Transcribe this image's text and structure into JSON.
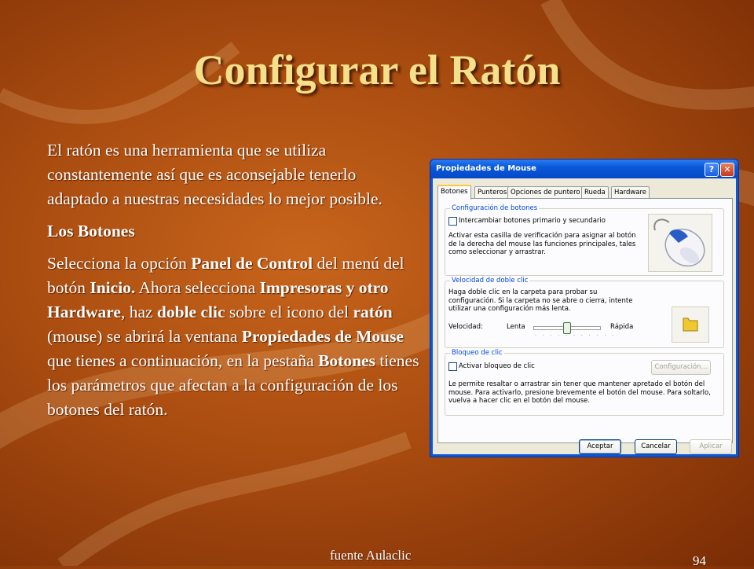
{
  "slide": {
    "title": "Configurar el Ratón",
    "source": "fuente Aulaclic",
    "page_number": "94"
  },
  "body": {
    "intro": "El ratón es una herramienta que se utiliza constantemente así que es aconsejable tenerlo adaptado a nuestras necesidades lo mejor posible.",
    "heading": "Los Botones",
    "p_s1": "Selecciona la opción ",
    "p_b1": "Panel de Control",
    "p_s2": " del menú del botón ",
    "p_b2": "Inicio.",
    "p_s3": " Ahora selecciona ",
    "p_b3": "Impresoras y otro Hardware",
    "p_s4": ", haz ",
    "p_b4": "doble clic",
    "p_s5": " sobre el icono del ",
    "p_b5": "ratón",
    "p_s6": " (mouse) se abrirá la ventana ",
    "p_b6": "Propiedades de Mouse",
    "p_s7": " que tienes a continuación, en la pestaña ",
    "p_b7": "Botones",
    "p_s8": " tienes los parámetros que afectan a la configuración de los botones del ratón."
  },
  "dialog": {
    "title": "Propiedades de Mouse",
    "help_icon": "?",
    "close_icon": "✕",
    "tabs": [
      "Botones",
      "Punteros",
      "Opciones de puntero",
      "Rueda",
      "Hardware"
    ],
    "group1": {
      "legend": "Configuración de botones",
      "checkbox_label": "Intercambiar botones primario y secundario",
      "description": "Activar esta casilla de verificación para asignar al botón de la derecha del mouse las funciones principales, tales como seleccionar y arrastrar."
    },
    "group2": {
      "legend": "Velocidad de doble clic",
      "description": "Haga doble clic en la carpeta para probar su configuración. Si la carpeta no se abre o cierra, intente utilizar una configuración más lenta.",
      "speed_label": "Velocidad:",
      "slow_label": "Lenta",
      "fast_label": "Rápida",
      "slider_value": 0.5
    },
    "group3": {
      "legend": "Bloqueo de clic",
      "checkbox_label": "Activar bloqueo de clic",
      "settings_button": "Configuración...",
      "description": "Le permite resaltar o arrastrar sin tener que mantener apretado el botón del mouse. Para activarlo, presione brevemente el botón del mouse. Para soltarlo, vuelva a hacer clic en el botón del mouse."
    },
    "buttons": {
      "ok": "Aceptar",
      "cancel": "Cancelar",
      "apply": "Aplicar"
    }
  },
  "colors": {
    "title": "#f4e08a",
    "text": "#ffffff",
    "xp_blue": "#0a58d8",
    "legend_blue": "#0046d5"
  }
}
